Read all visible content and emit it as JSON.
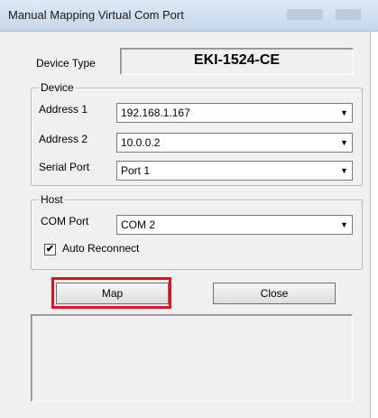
{
  "window": {
    "title": "Manual Mapping Virtual Com Port"
  },
  "device_type": {
    "label": "Device Type",
    "value": "EKI-1524-CE"
  },
  "device_group": {
    "legend": "Device",
    "address1": {
      "label": "Address 1",
      "value": "192.168.1.167"
    },
    "address2": {
      "label": "Address 2",
      "value": "10.0.0.2"
    },
    "serial_port": {
      "label": "Serial Port",
      "value": "Port 1"
    }
  },
  "host_group": {
    "legend": "Host",
    "com_port": {
      "label": "COM Port",
      "value": "COM 2"
    },
    "auto_reconnect": {
      "label": "Auto Reconnect",
      "checked": true,
      "mark": "✔"
    }
  },
  "buttons": {
    "map": "Map",
    "close": "Close"
  },
  "icons": {
    "dropdown": "chevron-down-icon",
    "check": "checkmark-icon"
  },
  "colors": {
    "highlight": "#e3101f",
    "window_bg": "#f0f0f0"
  }
}
